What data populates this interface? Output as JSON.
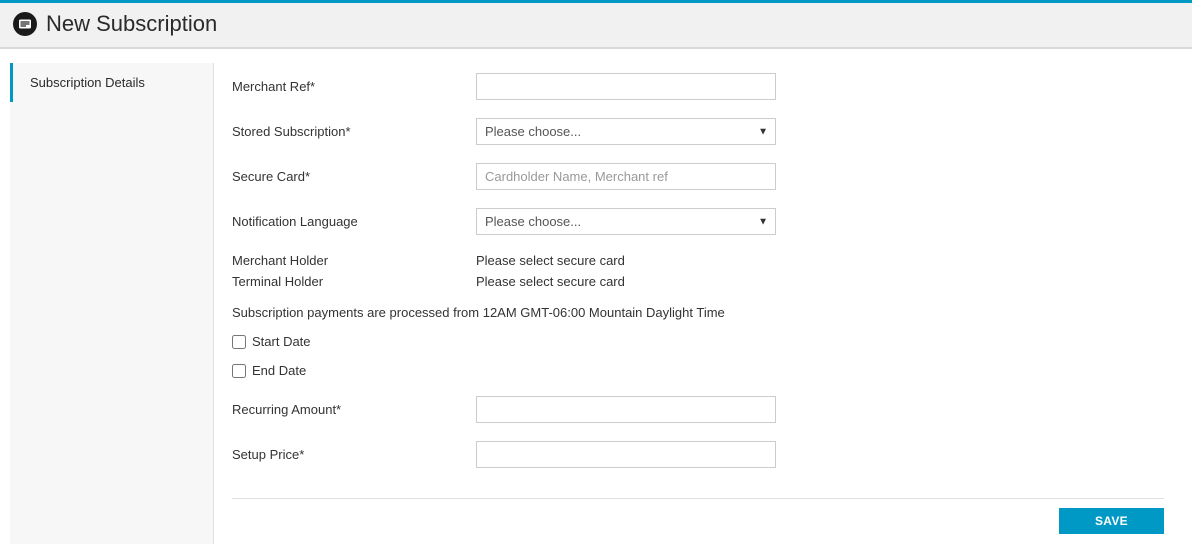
{
  "header": {
    "title": "New Subscription"
  },
  "sidebar": {
    "items": [
      {
        "label": "Subscription Details"
      }
    ]
  },
  "form": {
    "merchant_ref_label": "Merchant Ref*",
    "merchant_ref_value": "",
    "stored_subscription_label": "Stored Subscription*",
    "stored_subscription_value": "Please choose...",
    "secure_card_label": "Secure Card*",
    "secure_card_placeholder": "Cardholder Name, Merchant ref",
    "secure_card_value": "",
    "notification_language_label": "Notification Language",
    "notification_language_value": "Please choose...",
    "merchant_holder_label": "Merchant Holder",
    "merchant_holder_value": "Please select secure card",
    "terminal_holder_label": "Terminal Holder",
    "terminal_holder_value": "Please select secure card",
    "info_line": "Subscription payments are processed from 12AM GMT-06:00 Mountain Daylight Time",
    "start_date_label": "Start Date",
    "start_date_checked": false,
    "end_date_label": "End Date",
    "end_date_checked": false,
    "recurring_amount_label": "Recurring Amount*",
    "recurring_amount_value": "",
    "setup_price_label": "Setup Price*",
    "setup_price_value": ""
  },
  "actions": {
    "save_label": "SAVE"
  }
}
